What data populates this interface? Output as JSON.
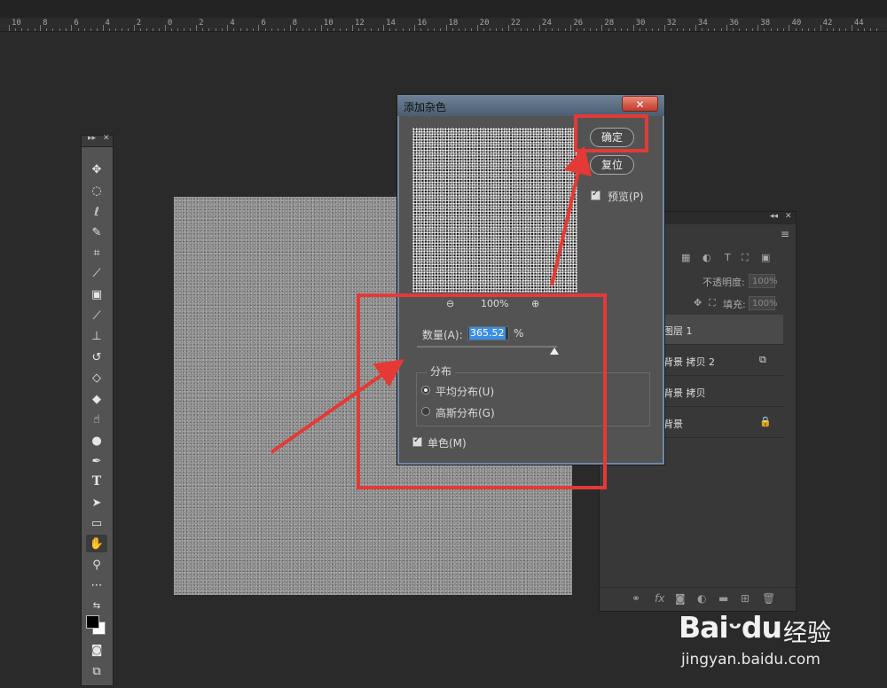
{
  "ruler": {
    "labels": [
      "10",
      "8",
      "6",
      "4",
      "2",
      "0",
      "2",
      "4",
      "6",
      "8",
      "10",
      "12",
      "14",
      "16",
      "18",
      "20",
      "22",
      "24",
      "26",
      "28",
      "30",
      "32",
      "34",
      "36",
      "38",
      "40",
      "42",
      "44"
    ]
  },
  "toolbox": {
    "tools": [
      "move-tool",
      "marquee-tool",
      "lasso-tool",
      "quick-select-tool",
      "crop-tool",
      "eyedropper-tool",
      "healing-brush-tool",
      "brush-tool",
      "clone-stamp-tool",
      "history-brush-tool",
      "eraser-tool",
      "paint-bucket-tool",
      "smudge-tool",
      "dodge-tool",
      "pen-tool",
      "type-tool",
      "path-select-tool",
      "rectangle-tool",
      "hand-tool",
      "zoom-tool",
      "more-tools"
    ],
    "type_glyph": "T"
  },
  "dialog": {
    "title": "添加杂色",
    "close_glyph": "✕",
    "ok_label": "确定",
    "reset_label": "复位",
    "preview_label": "预览(P)",
    "zoom_level": "100%",
    "amount_label": "数量(A):",
    "amount_value": "365.52",
    "amount_unit": "%",
    "distribution_label": "分布",
    "uniform_label": "平均分布(U)",
    "gaussian_label": "高斯分布(G)",
    "monochrome_label": "单色(M)",
    "preview_checked": true,
    "monochrome_checked": true,
    "selected_distribution": "uniform"
  },
  "layers": {
    "opacity_label": "不透明度:",
    "opacity_value": "100%",
    "fill_label": "填充:",
    "fill_value": "100%",
    "items": [
      {
        "name": "图层 1",
        "selected": true,
        "mark": ""
      },
      {
        "name": "背景 拷贝 2",
        "selected": false,
        "mark": "⧉"
      },
      {
        "name": "背景 拷贝",
        "selected": false,
        "mark": ""
      },
      {
        "name": "背景",
        "selected": false,
        "mark": "🔒"
      }
    ],
    "bottom_icons": [
      "link-icon",
      "fx-icon",
      "mask-icon",
      "adjustment-icon",
      "folder-icon",
      "new-layer-icon",
      "trash-icon"
    ]
  },
  "watermark": {
    "brand": "Bai",
    "brand_suffix": "du",
    "chinese": "经验",
    "url": "jingyan.baidu.com"
  },
  "colors": {
    "annotation_red": "#e53935",
    "dialog_bg": "#535353",
    "app_bg": "#2a2a2a"
  }
}
